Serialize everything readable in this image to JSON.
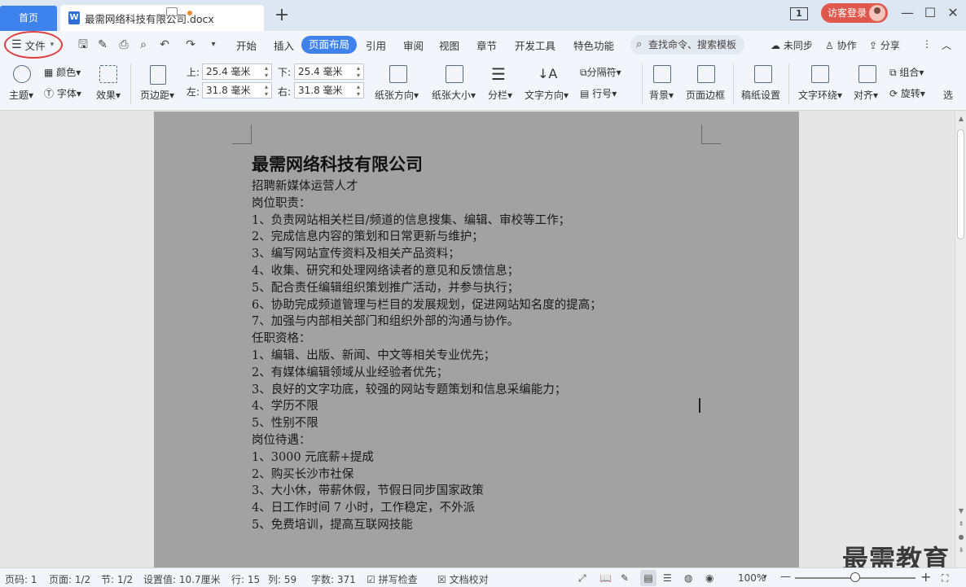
{
  "tabs": {
    "home_label": "首页",
    "doc_label": "最需网络科技有限公司.docx",
    "doc_icon_letter": "W",
    "add_symbol": "+"
  },
  "window": {
    "workspace_count": "1",
    "login_label": "访客登录",
    "minimize": "—",
    "maximize": "☐",
    "close": "✕"
  },
  "menu": {
    "file_label": "文件",
    "items": [
      "开始",
      "插入",
      "页面布局",
      "引用",
      "审阅",
      "视图",
      "章节",
      "开发工具",
      "特色功能"
    ],
    "active_item": "页面布局",
    "search_placeholder": "查找命令、搜索模板",
    "sync_label": "未同步",
    "collab_label": "协作",
    "share_label": "分享",
    "more_symbol": "⋮",
    "collapse_symbol": "︿"
  },
  "ribbon": {
    "theme_label": "主题",
    "color_label": "颜色",
    "font_label": "字体",
    "effect_label": "效果",
    "margin_label": "页边距",
    "margins": {
      "top_label": "上:",
      "top_value": "25.4 毫米",
      "bottom_label": "下:",
      "bottom_value": "25.4 毫米",
      "left_label": "左:",
      "left_value": "31.8 毫米",
      "right_label": "右:",
      "right_value": "31.8 毫米"
    },
    "orientation_label": "纸张方向",
    "size_label": "纸张大小",
    "columns_label": "分栏",
    "text_direction_label": "文字方向",
    "separator_label": "分隔符",
    "line_number_label": "行号",
    "background_label": "背景",
    "page_border_label": "页面边框",
    "manuscript_label": "稿纸设置",
    "wrap_label": "文字环绕",
    "align_label": "对齐",
    "group_label": "组合",
    "rotate_label": "旋转",
    "select_label": "选"
  },
  "document": {
    "title": "最需网络科技有限公司",
    "lines": [
      "招聘新媒体运营人才",
      "岗位职责：",
      "1、负责网站相关栏目/频道的信息搜集、编辑、审校等工作；",
      "2、完成信息内容的策划和日常更新与维护；",
      "3、编写网站宣传资料及相关产品资料；",
      "4、收集、研究和处理网络读者的意见和反馈信息；",
      "5、配合责任编辑组织策划推广活动，并参与执行；",
      "6、协助完成频道管理与栏目的发展规划，促进网站知名度的提高；",
      "7、加强与内部相关部门和组织外部的沟通与协作。",
      "任职资格：",
      "1、编辑、出版、新闻、中文等相关专业优先；",
      "2、有媒体编辑领域从业经验者优先；",
      "3、良好的文字功底，较强的网站专题策划和信息采编能力；",
      "4、学历不限",
      "5、性别不限",
      "岗位待遇：",
      "1、3000 元底薪+提成",
      "2、购买长沙市社保",
      "3、大小休，带薪休假，节假日同步国家政策",
      "4、日工作时间 7 小时，工作稳定，不外派",
      "5、免费培训，提高互联网技能"
    ]
  },
  "watermark": "最需教育",
  "status": {
    "page_num": "页码: 1",
    "page_count": "页面: 1/2",
    "section": "节: 1/2",
    "setting_value": "设置值: 10.7厘米",
    "row": "行: 15",
    "col": "列: 59",
    "word_count": "字数: 371",
    "spellcheck": "拼写检查",
    "proofread": "文档校对",
    "zoom": "100%",
    "zoom_minus": "—",
    "zoom_plus": "+"
  }
}
